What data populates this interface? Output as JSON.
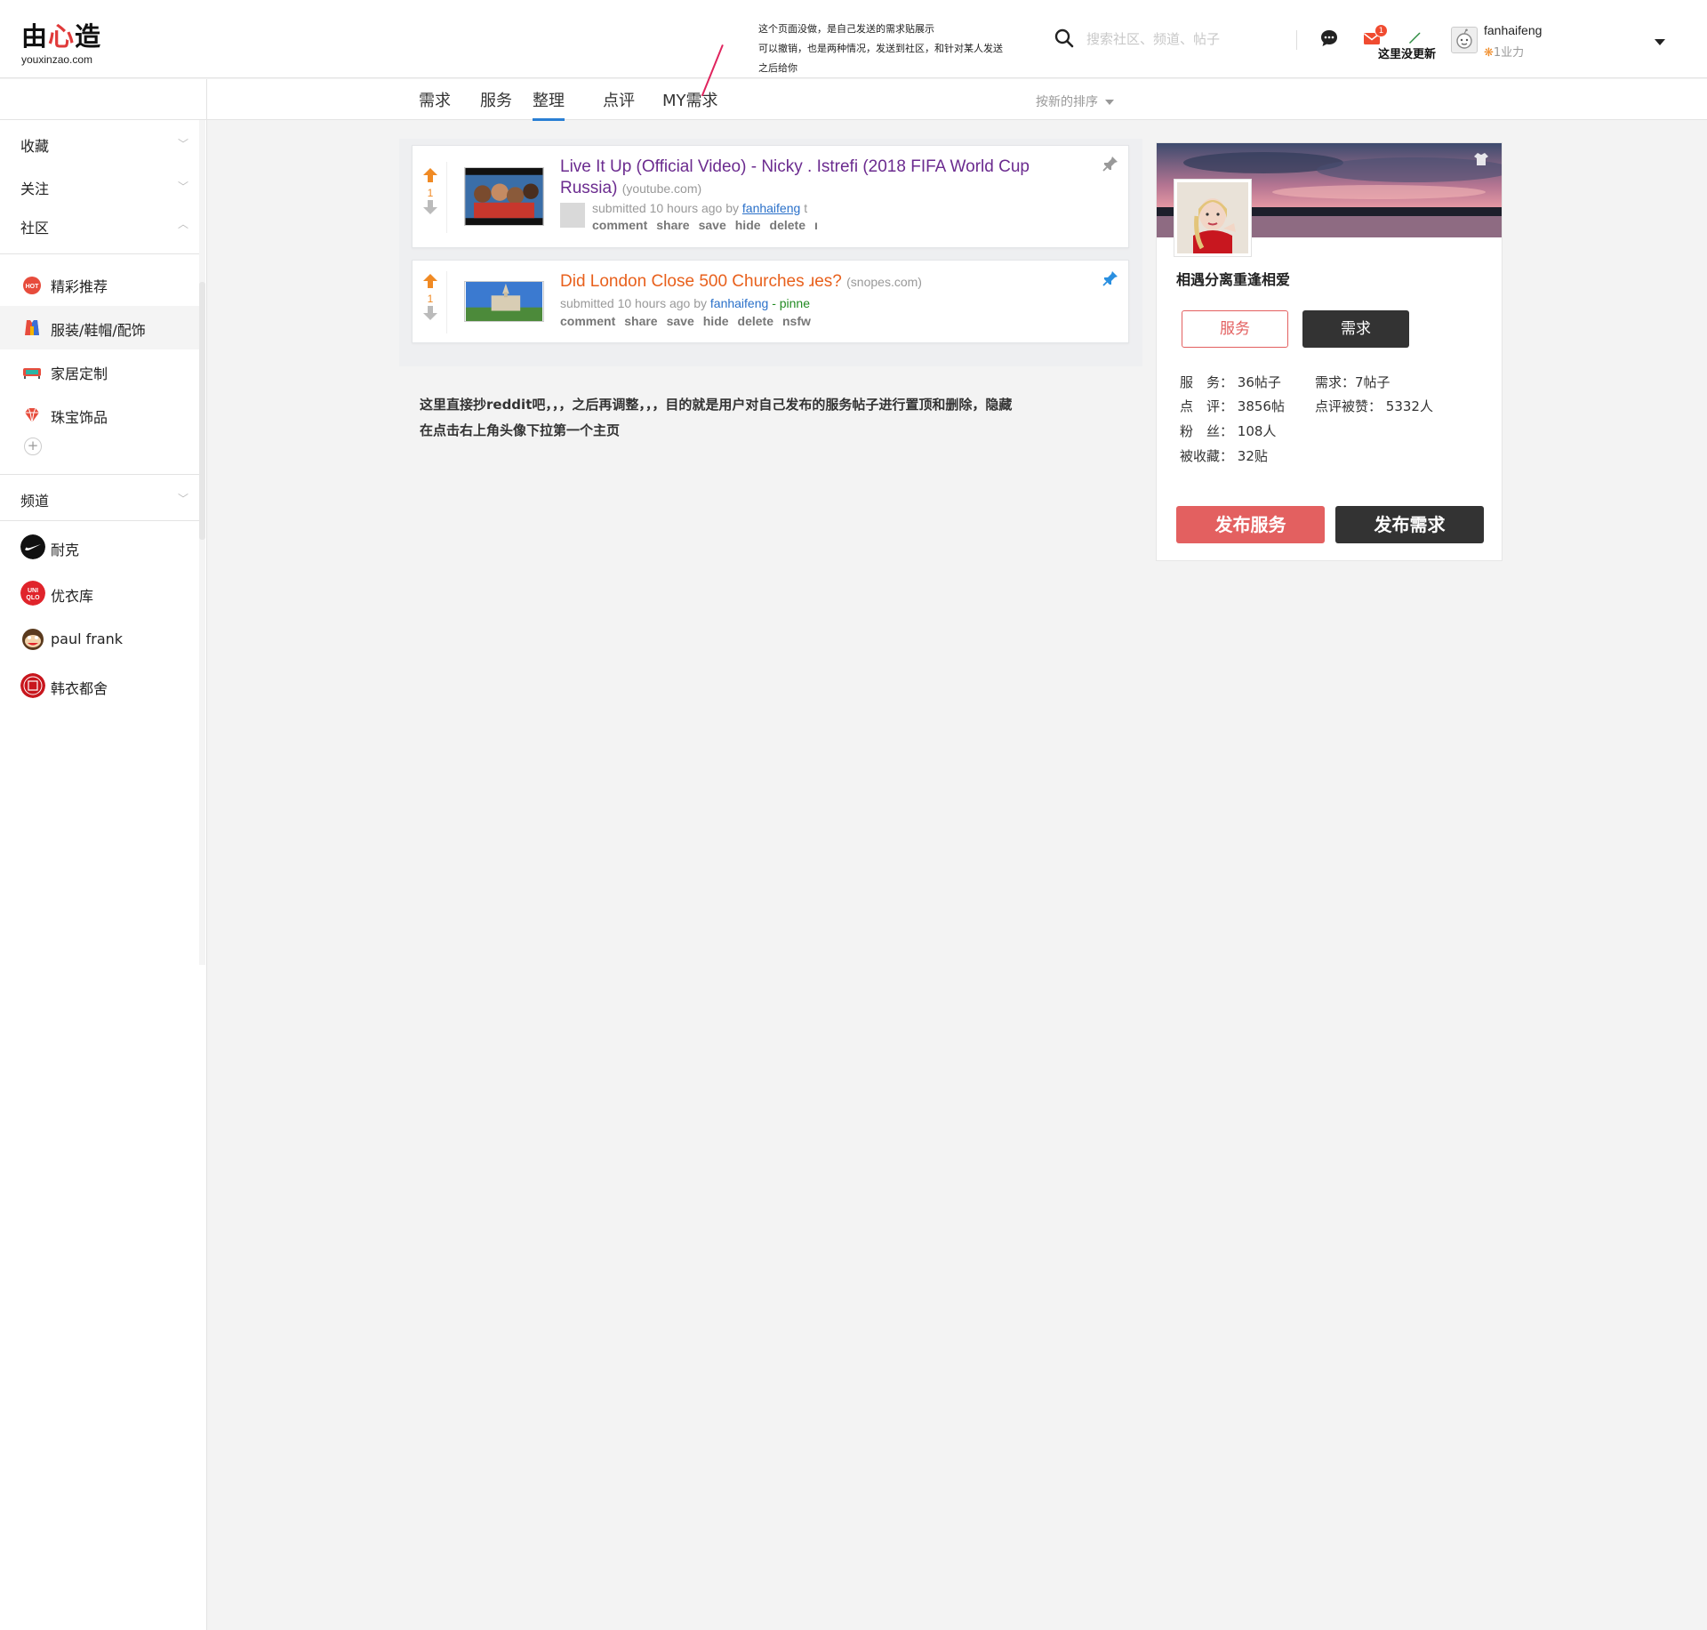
{
  "logo": {
    "main_before": "由",
    "main_heart": "心",
    "main_after": "造",
    "sub": "youxinzao.com"
  },
  "note": {
    "line1": "这个页面没做，是自己发送的需求贴展示",
    "line2": "可以撤销，也是两种情况，发送到社区，和针对某人发送",
    "line3": "之后给你"
  },
  "search": {
    "placeholder": "搜索社区、频道、帖子"
  },
  "header": {
    "mail_count": "1",
    "update_note": "这里没更新",
    "username": "fanhaifeng",
    "karma_star": "❋",
    "karma": "1业力"
  },
  "tabs": [
    {
      "label": "需求"
    },
    {
      "label": "服务"
    },
    {
      "label": "整理"
    },
    {
      "label": "点评"
    },
    {
      "label": "MY需求"
    }
  ],
  "active_tab": "整理",
  "sort": {
    "label": "按新的排序"
  },
  "sidebar": {
    "sections": {
      "favorites": "收藏",
      "follow": "关注",
      "community": "社区",
      "channels": "频道"
    },
    "community_items": [
      {
        "label": "精彩推荐",
        "icon": "hot-icon"
      },
      {
        "label": "服装/鞋帽/配饰",
        "icon": "clothing-icon"
      },
      {
        "label": "家居定制",
        "icon": "sofa-icon"
      },
      {
        "label": "珠宝饰品",
        "icon": "gem-icon"
      }
    ],
    "add": "+",
    "channel_items": [
      {
        "label": "耐克",
        "icon": "nike-icon"
      },
      {
        "label": "优衣库",
        "icon": "uniqlo-icon"
      },
      {
        "label": "paul frank",
        "icon": "paul-frank-icon"
      },
      {
        "label": "韩衣都舍",
        "icon": "handu-icon"
      }
    ]
  },
  "posts": [
    {
      "votes": "1",
      "title_line1": "Live It Up (Official Video) - Nicky . Istrefi (2018 FIFA World Cup",
      "title_line2": "Russia)",
      "domain": "(youtube.com)",
      "submitted": "submitted 10 hours ago by",
      "author": "fanhaifeng",
      "trail": "t",
      "actions": [
        "comment",
        "share",
        "save",
        "hide",
        "delete",
        "ı"
      ],
      "title_color": "#6b2b8f",
      "pin_color": "#999999"
    },
    {
      "votes": "1",
      "title": "Did London Close 500 Churches ɹes?",
      "domain": "(snopes.com)",
      "submitted": "submitted 10 hours ago by",
      "author": "fanhaifeng",
      "pinned": "- pinne",
      "actions": [
        "comment",
        "share",
        "save",
        "hide",
        "delete",
        "nsfw"
      ],
      "title_color": "#e8601c",
      "pin_color": "#2a8fe0"
    }
  ],
  "description": {
    "line1": "这里直接抄reddit吧，，，之后再调整，，，目的就是用户对自己发布的服务帖子进行置顶和删除，隐藏",
    "line2": "在点击右上角头像下拉第一个主页"
  },
  "profile": {
    "name": "相遇分离重逢相爱",
    "btn_service": "服务",
    "btn_demand": "需求",
    "stats": {
      "service_label": "服　务：",
      "service_value": "36帖子",
      "demand_label": "需求：",
      "demand_value": "7帖子",
      "review_label": "点　评：",
      "review_value": "3856帖",
      "liked_label": "点评被赞：",
      "liked_value": "5332人",
      "fans_label": "粉　丝：",
      "fans_value": "108人",
      "collected_label": "被收藏：",
      "collected_value": "32贴"
    },
    "publish_service": "发布服务",
    "publish_demand": "发布需求"
  },
  "colors": {
    "accent_blue": "#2a7fd4",
    "service_red": "#e36060",
    "dark": "#333333",
    "upvote_orange": "#f08a24"
  }
}
